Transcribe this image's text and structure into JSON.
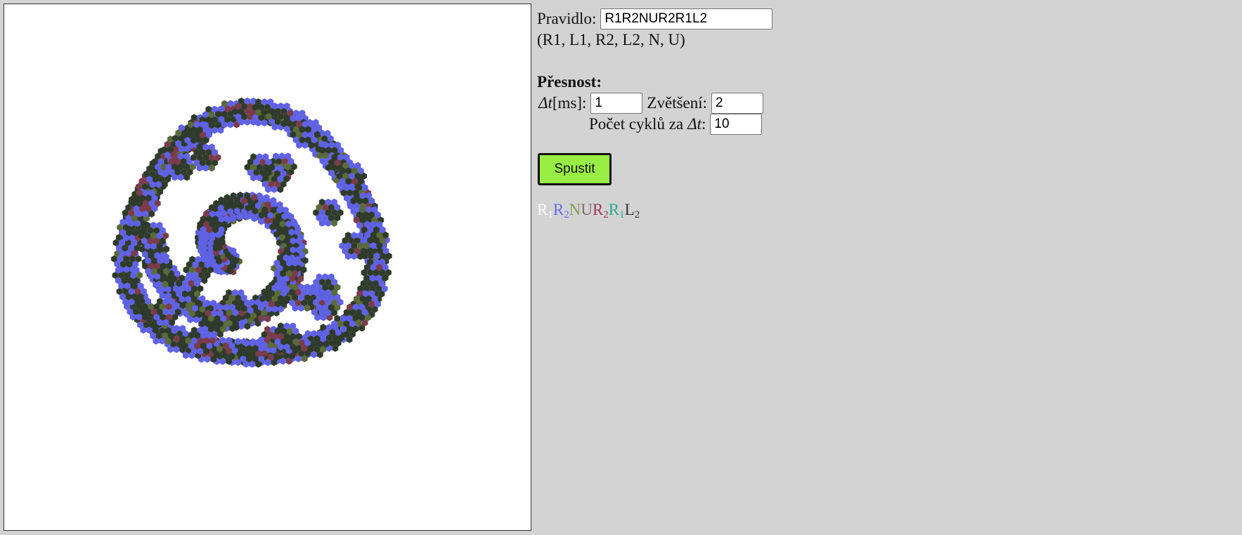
{
  "rule": {
    "label": "Pravidlo:",
    "value": "R1R2NUR2R1L2",
    "options": "(R1, L1, R2, L2, N, U)"
  },
  "precision": {
    "heading": "Přesnost:",
    "dt_symbol": "Δt",
    "dt_unit": "[ms]:",
    "dt_value": "1",
    "zoom_label": "Zvětšení:",
    "zoom_value": "2",
    "cycles_label": "Počet cyklů za",
    "cycles_symbol": "Δt",
    "cycles_colon": ":",
    "cycles_value": "10"
  },
  "run_button": {
    "label": "Spustit"
  },
  "colored_rule": [
    {
      "letter": "R",
      "sub": "1",
      "color": "#ffffff"
    },
    {
      "letter": "R",
      "sub": "2",
      "color": "#6a6ae8"
    },
    {
      "letter": "N",
      "sub": "",
      "color": "#8a9a56"
    },
    {
      "letter": "U",
      "sub": "",
      "color": "#7d6a6a"
    },
    {
      "letter": "R",
      "sub": "2",
      "color": "#9a3a5a"
    },
    {
      "letter": "R",
      "sub": "1",
      "color": "#2ea88a"
    },
    {
      "letter": "L",
      "sub": "2",
      "color": "#333333"
    }
  ],
  "palette": {
    "background": "#d3d3d3",
    "canvas": "#ffffff",
    "button": "#99ee44",
    "cells": [
      "#5f62e4",
      "#2f3b2a",
      "#7a3c4a",
      "#5a6a3a",
      "#2aa88a",
      "#222222"
    ]
  }
}
